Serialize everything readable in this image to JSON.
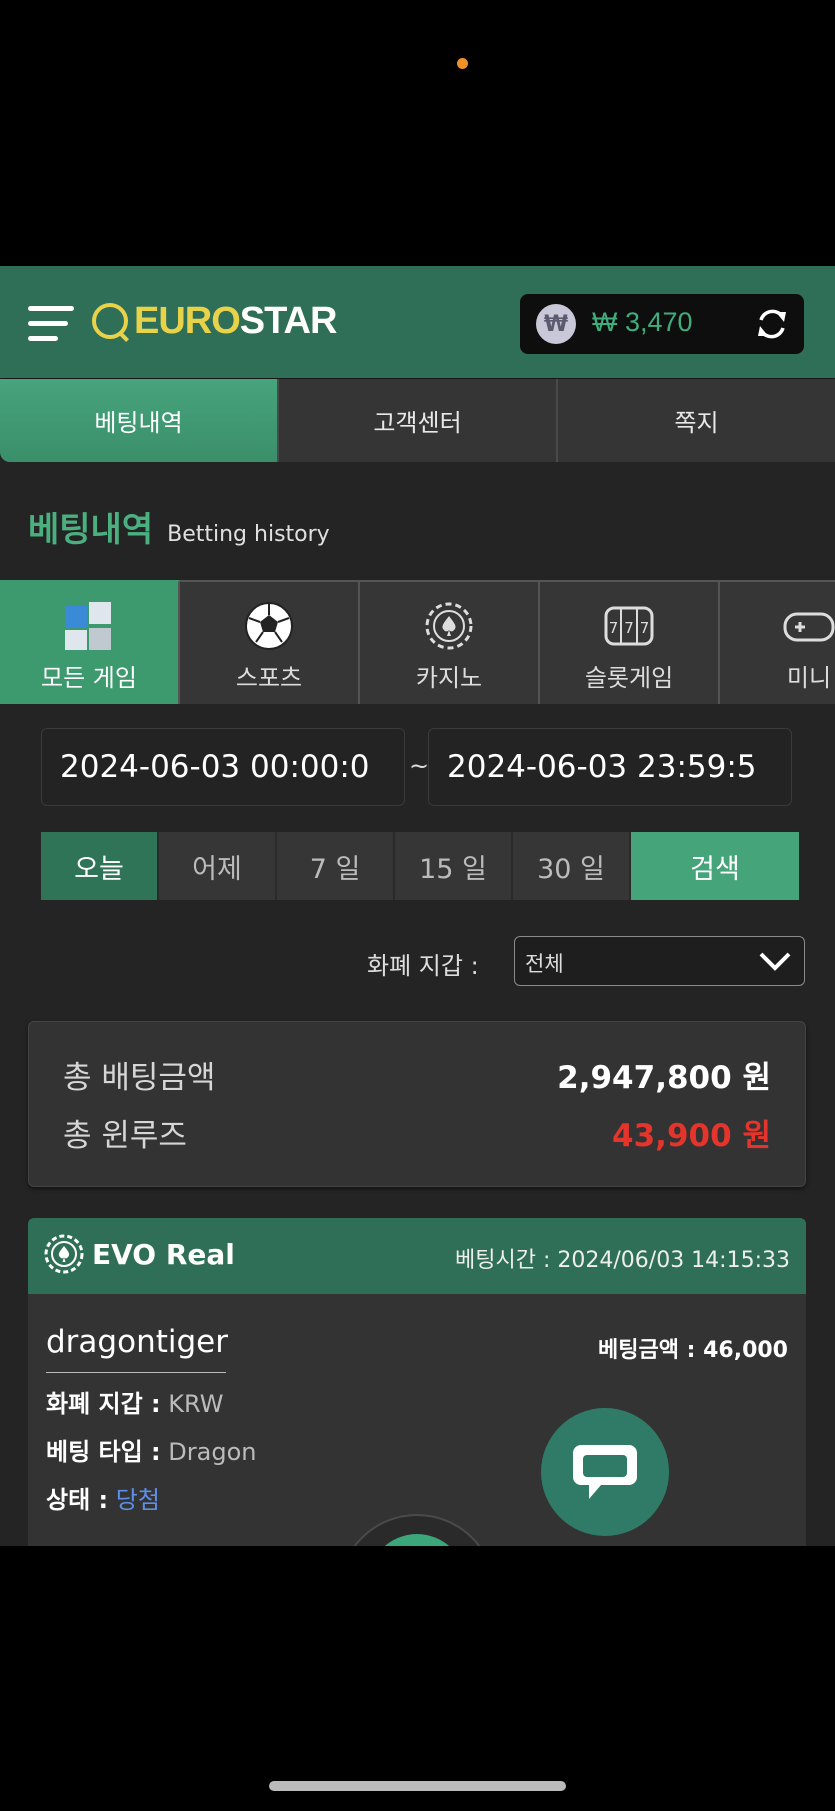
{
  "brand": {
    "part1": "EURO",
    "part2": "STAR"
  },
  "wallet": {
    "symbol": "₩",
    "balance": "₩ 3,470"
  },
  "tabs": [
    "베팅내역",
    "고객센터",
    "쪽지"
  ],
  "section": {
    "title": "베팅내역",
    "subtitle": "Betting history"
  },
  "categories": [
    "모든 게임",
    "스포츠",
    "카지노",
    "슬롯게임",
    "미니"
  ],
  "dates": {
    "start": "2024-06-03 00:00:0",
    "end": "2024-06-03 23:59:5",
    "separator": "~"
  },
  "quick": {
    "today": "오늘",
    "yesterday": "어제",
    "d7": "7 일",
    "d15": "15 일",
    "d30": "30 일",
    "search": "검색"
  },
  "currency": {
    "label": "화폐 지갑 :",
    "selected": "전체"
  },
  "summary": {
    "total_bet_label": "총 배팅금액",
    "total_bet_value": "2,947,800 원",
    "winloss_label": "총 윈루즈",
    "winloss_value": "43,900 원"
  },
  "bet": {
    "provider": "EVO Real",
    "time": "베팅시간 : 2024/06/03 14:15:33",
    "game": "dragontiger",
    "amount": "베팅금액 : 46,000",
    "currency_label": "화폐 지갑 :",
    "currency_value": "KRW",
    "type_label": "베팅 타입 :",
    "type_value": "Dragon",
    "status_label": "상태 :",
    "status_value": "당첨"
  },
  "colors": {
    "primary": "#3c9a6e",
    "header": "#2f6f57",
    "loss": "#e5342c",
    "win_status": "#5e8ee6",
    "logo": "#e8d24a"
  }
}
